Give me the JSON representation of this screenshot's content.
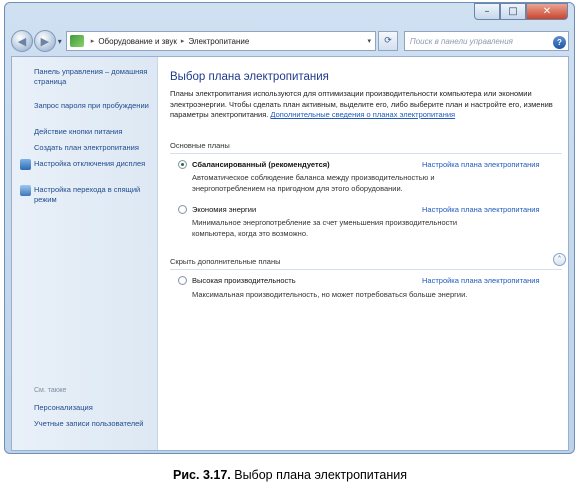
{
  "window": {
    "controls": {
      "minimize": "–",
      "maximize": "□",
      "close": "✕"
    }
  },
  "nav": {
    "back_icon": "◀",
    "forward_icon": "▶",
    "history_dropdown": "▾",
    "breadcrumb": [
      "Оборудование и звук",
      "Электропитание"
    ],
    "breadcrumb_sep": "▸",
    "address_dropdown": "▾",
    "refresh_icon": "⟳",
    "search_placeholder": "Поиск в панели управления",
    "search_icon": "⌕"
  },
  "sidebar": {
    "links": [
      "Панель управления – домашняя страница",
      "Запрос пароля при пробуждении",
      "Действие кнопки питания",
      "Создать план электропитания",
      "Настройка отключения дисплея",
      "Настройка перехода в спящий режим"
    ],
    "see_also_label": "См. также",
    "see_also_links": [
      "Персонализация",
      "Учетные записи пользователей"
    ]
  },
  "main": {
    "help_icon": "?",
    "title": "Выбор плана электропитания",
    "description": "Планы электропитания используются для оптимизации производительности компьютера или экономии электроэнергии. Чтобы сделать план активным, выделите его, либо выберите план и настройте его, изменив параметры электропитания. ",
    "description_link": "Дополнительные сведения о планах электропитания",
    "main_plans_header": "Основные планы",
    "hidden_plans_header": "Скрыть дополнительные планы",
    "collapse_icon": "˄",
    "plans": [
      {
        "name": "Сбалансированный (рекомендуется)",
        "selected": true,
        "link": "Настройка плана электропитания",
        "description": "Автоматическое соблюдение баланса между производительностью и энергопотреблением на пригодном для этого оборудовании."
      },
      {
        "name": "Экономия энергии",
        "selected": false,
        "link": "Настройка плана электропитания",
        "description": "Минимальное энергопотребление за счет уменьшения производительности компьютера, когда это возможно."
      },
      {
        "name": "Высокая производительность",
        "selected": false,
        "link": "Настройка плана электропитания",
        "description": "Максимальная производительность, но может потребоваться больше энергии."
      }
    ]
  },
  "caption": {
    "label": "Рис. 3.17.",
    "text": " Выбор плана электропитания"
  }
}
